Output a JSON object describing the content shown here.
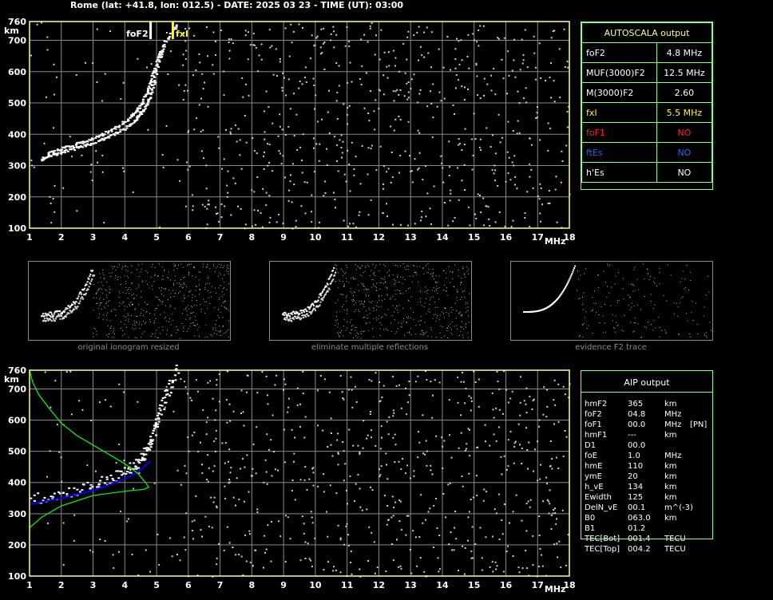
{
  "header": {
    "title": "Rome (lat: +41.8, lon: 012.5) - DATE: 2025 03 23 - TIME (UT): 03:00"
  },
  "colors": {
    "grid": "#8a8a8a",
    "frame": "#ffff88",
    "table_border": "#88ff88",
    "fxI": "#ffff00",
    "foF1": "#ff2020",
    "ftEs": "#2266ff",
    "profile": "#00ff00",
    "trace": "#0000ff"
  },
  "autoscala": {
    "title": "AUTOSCALA output",
    "rows": [
      {
        "label": "foF2",
        "value": "4.8 MHz",
        "color": "#ffffff"
      },
      {
        "label": "MUF(3000)F2",
        "value": "12.5 MHz",
        "color": "#ffffff"
      },
      {
        "label": "M(3000)F2",
        "value": "2.60",
        "color": "#ffffff"
      },
      {
        "label": "fxI",
        "value": "5.5 MHz",
        "color": "#ffff00"
      },
      {
        "label": "foF1",
        "value": "NO",
        "color": "#ff2020"
      },
      {
        "label": "ftEs",
        "value": "NO",
        "color": "#2266ff"
      },
      {
        "label": "h'Es",
        "value": "NO",
        "color": "#ffffff"
      }
    ]
  },
  "thumbnails": [
    {
      "caption": "original ionogram resized"
    },
    {
      "caption": "eliminate multiple reflections"
    },
    {
      "caption": "evidence F2 trace"
    }
  ],
  "aip": {
    "title": "AIP output",
    "rows": [
      {
        "name": "hmF2",
        "value": "365",
        "unit": "km",
        "extra": ""
      },
      {
        "name": "foF2",
        "value": "04.8",
        "unit": "MHz",
        "extra": ""
      },
      {
        "name": "foF1",
        "value": "00.0",
        "unit": "MHz",
        "extra": "[PN]"
      },
      {
        "name": "hmF1",
        "value": "---",
        "unit": "km",
        "extra": ""
      },
      {
        "name": "D1",
        "value": "00.0",
        "unit": "",
        "extra": ""
      },
      {
        "name": "foE",
        "value": "1.0",
        "unit": "MHz",
        "extra": ""
      },
      {
        "name": "hmE",
        "value": "110",
        "unit": "km",
        "extra": ""
      },
      {
        "name": "ymE",
        "value": "20",
        "unit": "km",
        "extra": ""
      },
      {
        "name": "h_vE",
        "value": "134",
        "unit": "km",
        "extra": ""
      },
      {
        "name": "Ewidth",
        "value": "125",
        "unit": "km",
        "extra": ""
      },
      {
        "name": "DelN_vE",
        "value": "00.1",
        "unit": "m^(-3)",
        "extra": ""
      },
      {
        "name": "B0",
        "value": "063.0",
        "unit": "km",
        "extra": ""
      },
      {
        "name": "B1",
        "value": "01.2",
        "unit": "",
        "extra": ""
      },
      {
        "name": "TEC[Bot]",
        "value": "001.4",
        "unit": "TECU",
        "extra": ""
      },
      {
        "name": "TEC[Top]",
        "value": "004.2",
        "unit": "TECU",
        "extra": ""
      }
    ]
  },
  "chart_data": [
    {
      "type": "scatter",
      "title": "",
      "xlabel": "MHz",
      "ylabel": "km",
      "xlim": [
        1,
        18
      ],
      "ylim": [
        100,
        760
      ],
      "x_ticks": [
        1,
        2,
        3,
        4,
        5,
        6,
        7,
        8,
        9,
        10,
        11,
        12,
        13,
        14,
        15,
        16,
        17,
        18
      ],
      "y_ticks": [
        100,
        200,
        300,
        400,
        500,
        600,
        700,
        760
      ],
      "grid": true,
      "markers": [
        {
          "name": "foF2",
          "x": 4.8
        },
        {
          "name": "fxI",
          "x": 5.5
        }
      ],
      "series": [
        {
          "points": [
            [
              1.3,
              325
            ],
            [
              1.6,
              338
            ],
            [
              2.0,
              350
            ],
            [
              2.5,
              365
            ],
            [
              3.0,
              380
            ],
            [
              3.5,
              400
            ],
            [
              4.0,
              428
            ],
            [
              4.3,
              455
            ],
            [
              4.5,
              480
            ],
            [
              4.7,
              520
            ],
            [
              4.85,
              570
            ],
            [
              5.0,
              640
            ],
            [
              5.2,
              700
            ],
            [
              5.6,
              760
            ]
          ]
        },
        {
          "points": [
            [
              1.5,
              345
            ],
            [
              2.0,
              362
            ],
            [
              2.5,
              378
            ],
            [
              3.0,
              395
            ],
            [
              3.5,
              418
            ],
            [
              4.0,
              450
            ],
            [
              4.3,
              480
            ],
            [
              4.5,
              510
            ],
            [
              4.7,
              560
            ],
            [
              4.9,
              620
            ],
            [
              5.1,
              680
            ]
          ]
        }
      ]
    },
    {
      "type": "line",
      "title": "",
      "xlabel": "MHz",
      "ylabel": "km",
      "xlim": [
        1,
        18
      ],
      "ylim": [
        100,
        760
      ],
      "x_ticks": [
        1,
        2,
        3,
        4,
        5,
        6,
        7,
        8,
        9,
        10,
        11,
        12,
        13,
        14,
        15,
        16,
        17,
        18
      ],
      "y_ticks": [
        100,
        200,
        300,
        400,
        500,
        600,
        700,
        760
      ],
      "grid": true,
      "series": [
        {
          "points": [
            [
              1.0,
              330
            ],
            [
              1.5,
              340
            ],
            [
              2.0,
              350
            ],
            [
              2.5,
              362
            ],
            [
              3.0,
              375
            ],
            [
              3.5,
              392
            ],
            [
              4.0,
              412
            ],
            [
              4.4,
              432
            ],
            [
              4.6,
              450
            ],
            [
              4.8,
              470
            ]
          ]
        },
        {
          "points": [
            [
              1.0,
              760
            ],
            [
              1.1,
              720
            ],
            [
              1.3,
              680
            ],
            [
              1.6,
              640
            ],
            [
              2.0,
              590
            ],
            [
              2.5,
              550
            ],
            [
              3.0,
              520
            ],
            [
              3.5,
              490
            ],
            [
              4.0,
              460
            ],
            [
              4.4,
              430
            ],
            [
              4.65,
              400
            ],
            [
              4.75,
              385
            ],
            [
              4.6,
              378
            ],
            [
              4.0,
              372
            ],
            [
              3.0,
              358
            ],
            [
              2.0,
              325
            ],
            [
              1.4,
              290
            ],
            [
              1.0,
              255
            ]
          ]
        }
      ]
    }
  ]
}
